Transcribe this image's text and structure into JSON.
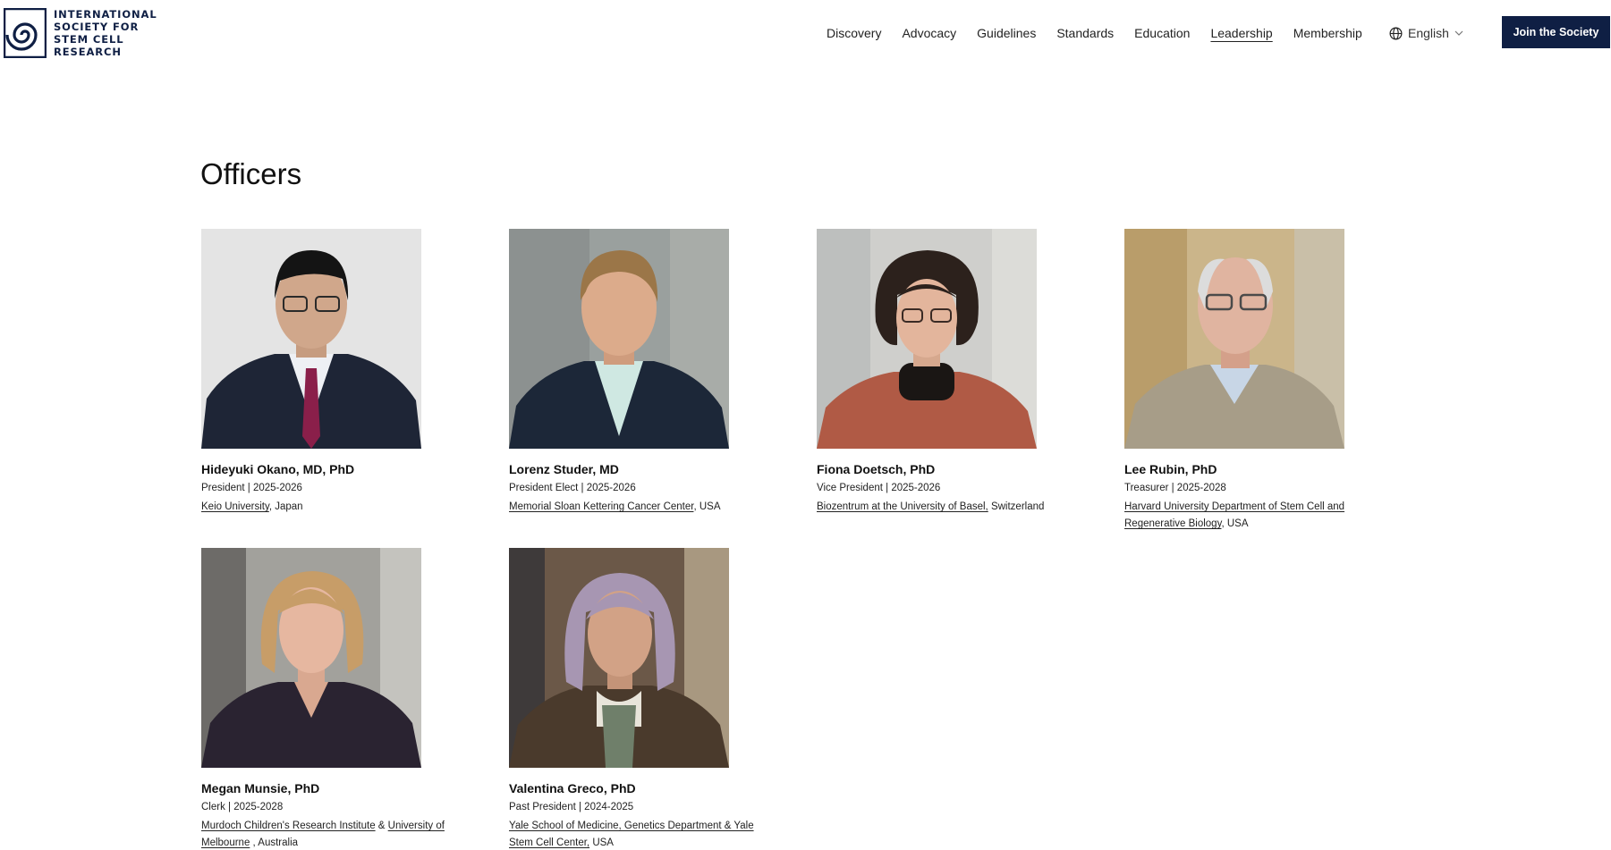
{
  "logo": {
    "lines": [
      "INTERNATIONAL",
      "SOCIETY FOR",
      "STEM CELL",
      "RESEARCH"
    ]
  },
  "nav": {
    "items": [
      "Discovery",
      "Advocacy",
      "Guidelines",
      "Standards",
      "Education",
      "Leadership",
      "Membership"
    ],
    "active": "Leadership"
  },
  "language": {
    "label": "English",
    "icon": "globe-icon"
  },
  "join_button": "Join the Society",
  "page_title": "Officers",
  "officers": [
    {
      "name": "Hideyuki Okano, MD, PhD",
      "role": "President | 2025-2026",
      "link1": "Keio University",
      "mid": "",
      "link2": "",
      "tail": ", Japan"
    },
    {
      "name": "Lorenz Studer, MD",
      "role": "President Elect | 2025-2026",
      "link1": "Memorial Sloan Kettering Cancer Center",
      "mid": "",
      "link2": "",
      "tail": ", USA"
    },
    {
      "name": "Fiona Doetsch, PhD",
      "role": "Vice President | 2025-2026",
      "link1": "Biozentrum at the University of Basel,",
      "mid": "",
      "link2": "",
      "tail": " Switzerland"
    },
    {
      "name": "Lee Rubin, PhD",
      "role": "Treasurer | 2025-2028",
      "link1": "Harvard University Department of Stem Cell and Regenerative Biology",
      "mid": "",
      "link2": "",
      "tail": ", USA"
    },
    {
      "name": "Megan Munsie, PhD",
      "role": "Clerk | 2025-2028",
      "link1": "Murdoch Children's Research Institute",
      "mid": " & ",
      "link2": "University of Melbourne",
      "tail": " , Australia"
    },
    {
      "name": "Valentina Greco, PhD",
      "role": "Past President | 2024-2025",
      "link1": "Yale School of Medicine, Genetics Department & Yale Stem Cell Center,",
      "mid": "",
      "link2": "",
      "tail": " USA"
    }
  ],
  "colors": {
    "brand_navy": "#0f1f44",
    "text": "#111111",
    "background": "#ffffff"
  }
}
